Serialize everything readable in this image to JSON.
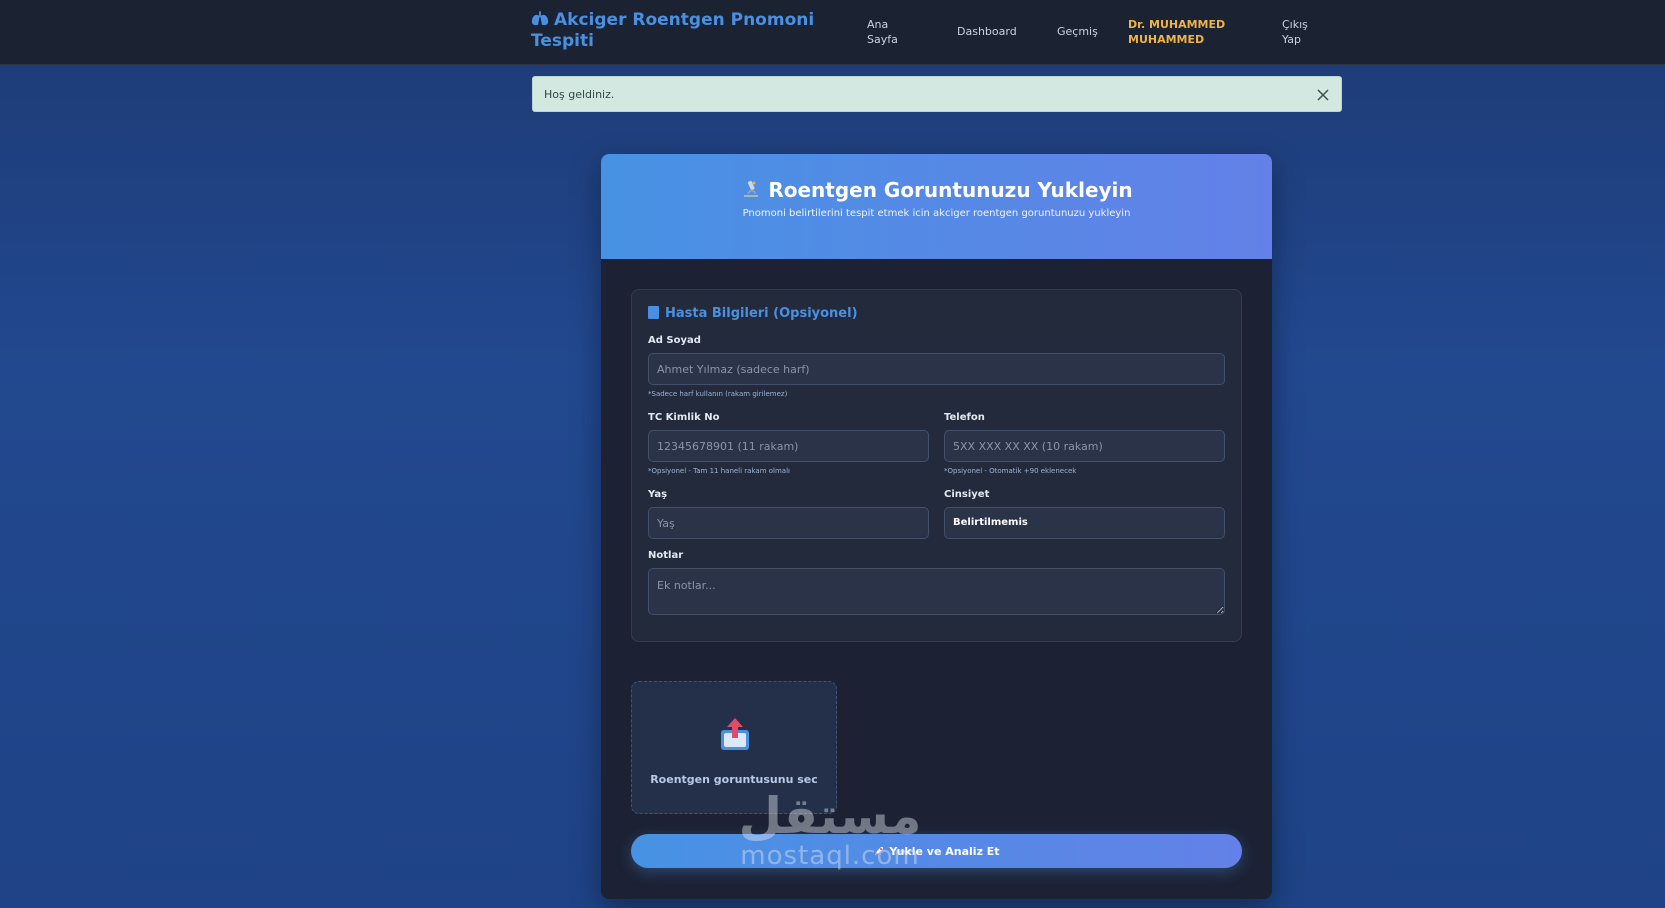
{
  "navbar": {
    "brand": "Akciger Roentgen Pnomoni Tespiti",
    "links": {
      "home": "Ana Sayfa",
      "dashboard": "Dashboard",
      "history": "Geçmiş",
      "user": "Dr. MUHAMMED MUHAMMED",
      "logout": "Çıkış Yap"
    }
  },
  "alert": {
    "message": "Hoş geldiniz."
  },
  "upload_card": {
    "title": "Roentgen Goruntunuzu Yukleyin",
    "subtitle": "Pnomoni belirtilerini tespit etmek icin akciger roentgen goruntunuzu yukleyin"
  },
  "patient_form": {
    "section_title": "Hasta Bilgileri (Opsiyonel)",
    "name": {
      "label": "Ad Soyad",
      "placeholder": "Ahmet Yılmaz (sadece harf)",
      "hint": "*Sadece harf kullanın (rakam girilemez)"
    },
    "tc": {
      "label": "TC Kimlik No",
      "placeholder": "12345678901 (11 rakam)",
      "hint": "*Opsiyonel - Tam 11 haneli rakam olmalı"
    },
    "phone": {
      "label": "Telefon",
      "placeholder": "5XX XXX XX XX (10 rakam)",
      "hint": "*Opsiyonel - Otomatik +90 eklenecek"
    },
    "age": {
      "label": "Yaş",
      "placeholder": "Yaş"
    },
    "gender": {
      "label": "Cinsiyet",
      "value": "Belirtilmemis"
    },
    "notes": {
      "label": "Notlar",
      "placeholder": "Ek notlar..."
    }
  },
  "upload": {
    "label": "Roentgen goruntusunu sec",
    "icon": "upload-icon"
  },
  "submit": {
    "label": "Yukle ve Analiz Et",
    "icon": "rocket-icon"
  },
  "watermark": {
    "arabic": "مستقل",
    "latin": "mostaql.com"
  },
  "colors": {
    "accent": "#4a90e2",
    "header_gradient_end": "#6381e8",
    "user_name": "#f0b34a",
    "alert_bg": "#d3e8e0",
    "card_bg": "#1c2234"
  }
}
